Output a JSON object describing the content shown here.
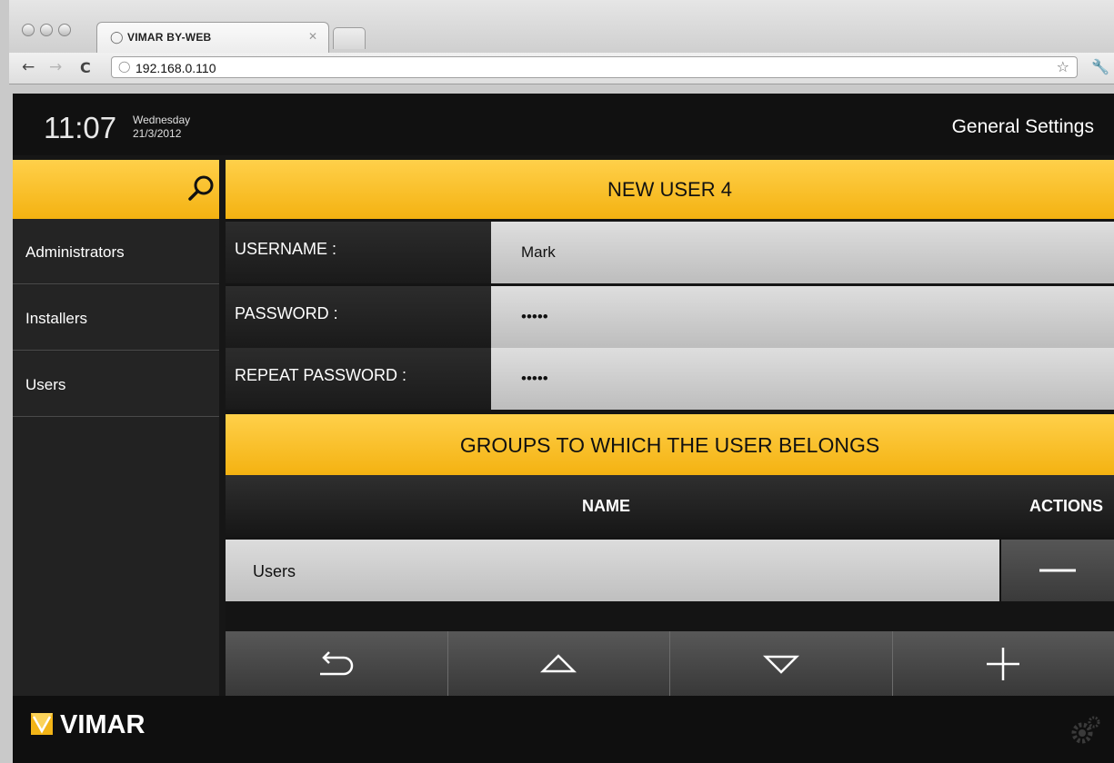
{
  "browser": {
    "tab_title": "VIMAR BY-WEB",
    "url": "192.168.0.110"
  },
  "header": {
    "time": "11:07",
    "day": "Wednesday",
    "date": "21/3/2012",
    "section": "General Settings"
  },
  "sidebar": {
    "items": [
      {
        "label": "Administrators"
      },
      {
        "label": "Installers"
      },
      {
        "label": "Users"
      }
    ]
  },
  "form": {
    "title": "NEW USER 4",
    "username_label": "USERNAME :",
    "username_value": "Mark",
    "password_label": "PASSWORD :",
    "password_value": "•••••",
    "repeat_label": "REPEAT PASSWORD :",
    "repeat_value": "•••••"
  },
  "groups": {
    "title": "GROUPS TO WHICH THE USER BELONGS",
    "col_name": "NAME",
    "col_actions": "ACTIONS",
    "rows": [
      {
        "name": "Users"
      }
    ]
  },
  "footer": {
    "brand": "VIMAR"
  },
  "colors": {
    "accent": "#f8c12a",
    "background": "#161616"
  }
}
